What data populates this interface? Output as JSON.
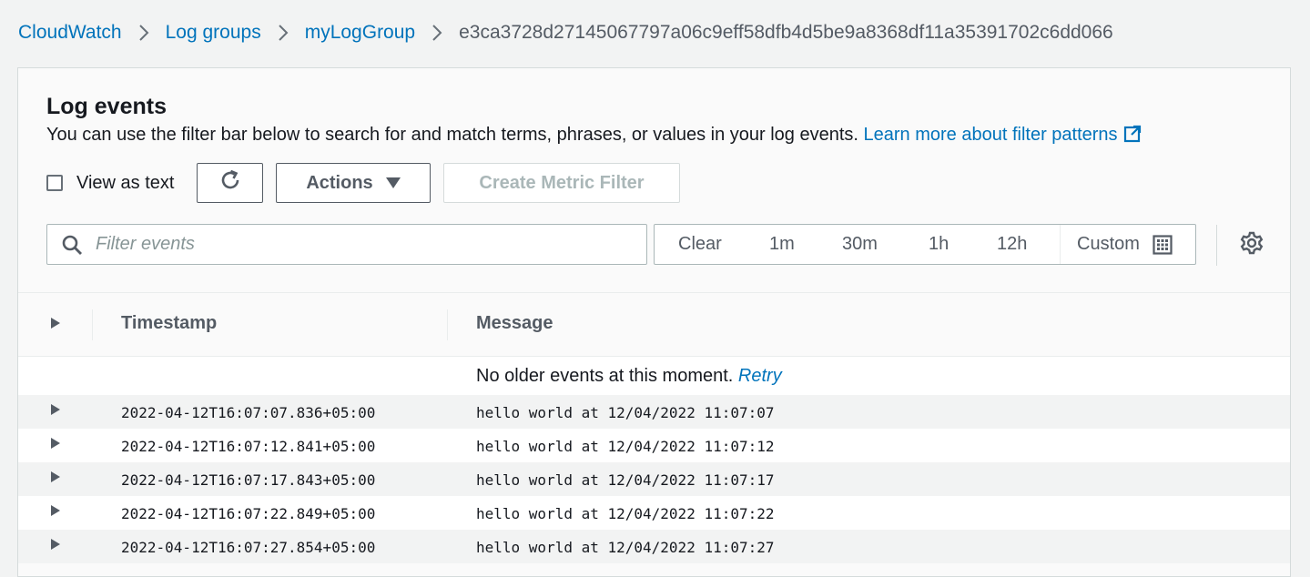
{
  "breadcrumb": {
    "items": [
      "CloudWatch",
      "Log groups",
      "myLogGroup"
    ],
    "current": "e3ca3728d27145067797a06c9eff58dfb4d5be9a8368df11a35391702c6dd066"
  },
  "panel": {
    "title": "Log events",
    "description": "You can use the filter bar below to search for and match terms, phrases, or values in your log events.",
    "learn_more": "Learn more about filter patterns"
  },
  "toolbar": {
    "view_as_text_label": "View as text",
    "actions_label": "Actions",
    "create_metric_filter_label": "Create Metric Filter"
  },
  "filter": {
    "placeholder": "Filter events",
    "value": ""
  },
  "time_range": {
    "clear": "Clear",
    "options": [
      "1m",
      "30m",
      "1h",
      "12h"
    ],
    "custom": "Custom"
  },
  "table": {
    "columns": [
      "Timestamp",
      "Message"
    ],
    "no_older_text": "No older events at this moment.",
    "retry": "Retry",
    "rows": [
      {
        "timestamp": "2022-04-12T16:07:07.836+05:00",
        "message": "hello world at 12/04/2022 11:07:07"
      },
      {
        "timestamp": "2022-04-12T16:07:12.841+05:00",
        "message": "hello world at 12/04/2022 11:07:12"
      },
      {
        "timestamp": "2022-04-12T16:07:17.843+05:00",
        "message": "hello world at 12/04/2022 11:07:17"
      },
      {
        "timestamp": "2022-04-12T16:07:22.849+05:00",
        "message": "hello world at 12/04/2022 11:07:22"
      },
      {
        "timestamp": "2022-04-12T16:07:27.854+05:00",
        "message": "hello world at 12/04/2022 11:07:27"
      }
    ]
  },
  "colors": {
    "link": "#0073bb",
    "text": "#16191f",
    "muted": "#545b64",
    "disabled": "#aab7b8"
  }
}
